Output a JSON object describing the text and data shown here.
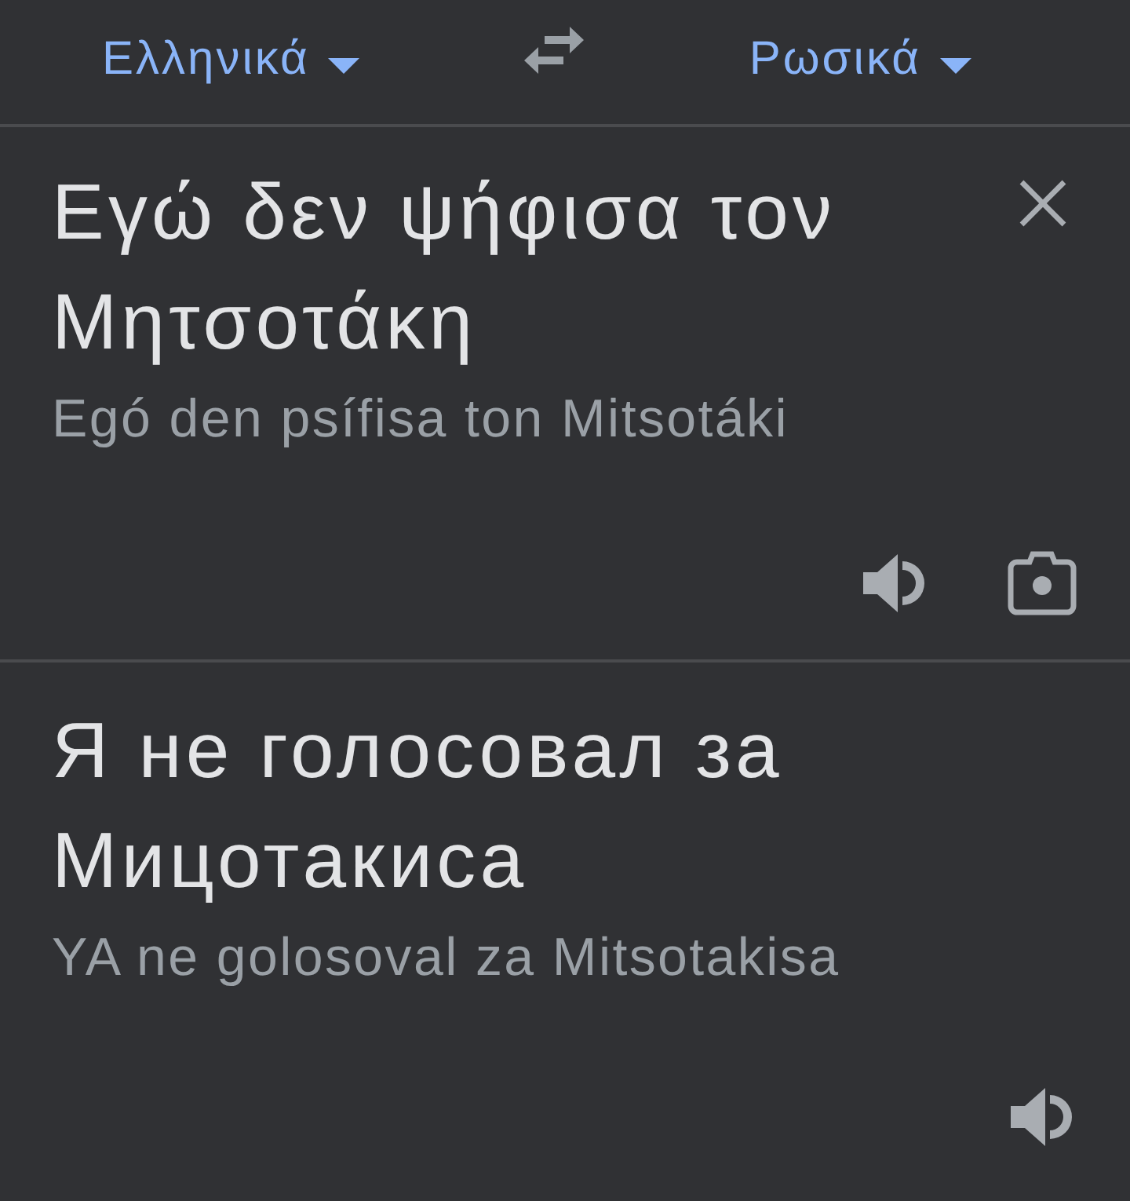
{
  "header": {
    "source_language": {
      "label": "Ελληνικά"
    },
    "target_language": {
      "label": "Ρωσικά"
    }
  },
  "source": {
    "text": "Εγώ δεν ψήφισα τον Μητσοτάκη",
    "transliteration": "Egó den psífisa ton Mitsotáki"
  },
  "translation": {
    "text": "Я не голосовал за Мицотакиса",
    "transliteration": "YA ne golosoval za Mitsotakisa"
  }
}
